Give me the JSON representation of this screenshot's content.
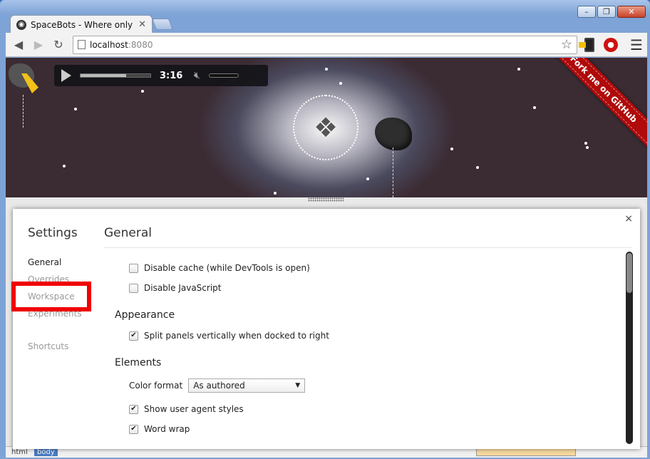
{
  "window": {
    "tab_title": "SpaceBots - Where only li",
    "controls": [
      "–",
      "❐",
      "✕"
    ]
  },
  "toolbar": {
    "url_host": "localhost",
    "url_port": ":8080"
  },
  "player": {
    "time": "3:16",
    "progress": 0.65
  },
  "ribbon": {
    "label": "Fork me on GitHub"
  },
  "settings": {
    "side_title": "Settings",
    "nav": [
      "General",
      "Overrides",
      "Workspace",
      "Experiments",
      "Shortcuts"
    ],
    "active_nav": "General",
    "main_title": "General",
    "options": {
      "disable_cache": {
        "label": "Disable cache (while DevTools is open)",
        "checked": false
      },
      "disable_js": {
        "label": "Disable JavaScript",
        "checked": false
      }
    },
    "appearance": {
      "title": "Appearance",
      "split_panels": {
        "label": "Split panels vertically when docked to right",
        "checked": true
      }
    },
    "elements": {
      "title": "Elements",
      "color_format_label": "Color format",
      "color_format_value": "As authored",
      "show_ua_styles": {
        "label": "Show user agent styles",
        "checked": true
      },
      "word_wrap": {
        "label": "Word wrap",
        "checked": true
      }
    },
    "close": "×"
  },
  "devtools": {
    "crumbs": [
      "html",
      "body"
    ]
  },
  "colors": {
    "highlight": "#f00000",
    "ribbon": "#b00a0a"
  }
}
